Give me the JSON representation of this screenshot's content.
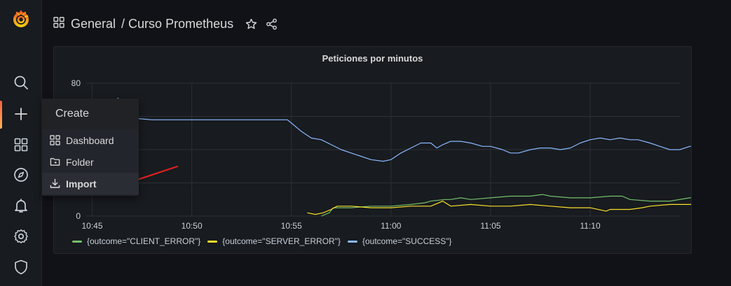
{
  "sidebar": {
    "items": [
      {
        "name": "grafana-logo",
        "icon": "grafana-logo-icon"
      },
      {
        "name": "search",
        "icon": "search-icon"
      },
      {
        "name": "create",
        "icon": "plus-icon",
        "active": true
      },
      {
        "name": "dashboards",
        "icon": "grid-icon"
      },
      {
        "name": "explore",
        "icon": "compass-icon"
      },
      {
        "name": "alerting",
        "icon": "bell-icon"
      },
      {
        "name": "configuration",
        "icon": "gear-icon"
      },
      {
        "name": "server-admin",
        "icon": "shield-icon"
      }
    ]
  },
  "breadcrumb": {
    "folder": "General",
    "title": "/ Curso Prometheus"
  },
  "create_menu": {
    "header": "Create",
    "items": [
      {
        "label": "Dashboard",
        "icon": "grid-icon"
      },
      {
        "label": "Folder",
        "icon": "folder-icon"
      },
      {
        "label": "Import",
        "icon": "import-icon",
        "highlighted": true
      }
    ]
  },
  "panel": {
    "title": "Peticiones por minutos"
  },
  "chart_data": {
    "type": "line",
    "title": "Peticiones por minutos",
    "xlabel": "",
    "ylabel": "",
    "x_ticks": [
      "10:45",
      "10:50",
      "10:55",
      "11:00",
      "11:05",
      "11:10"
    ],
    "y_ticks": [
      "0",
      "80"
    ],
    "xlim_minutes": [
      "10:44",
      "11:15"
    ],
    "ylim": [
      0,
      80
    ],
    "grid": true,
    "legend_position": "bottom",
    "series": [
      {
        "name": "{outcome=\"CLIENT_ERROR\"}",
        "color": "#73bf69",
        "points": [
          [
            56.5,
            0
          ],
          [
            56.9,
            2
          ],
          [
            57.1,
            5
          ],
          [
            58,
            5
          ],
          [
            59,
            6
          ],
          [
            60,
            6
          ],
          [
            61,
            7
          ],
          [
            61.7,
            8
          ],
          [
            62,
            9
          ],
          [
            62.7,
            10
          ],
          [
            63,
            10
          ],
          [
            63.5,
            11
          ],
          [
            64,
            10
          ],
          [
            65,
            11
          ],
          [
            66,
            12
          ],
          [
            67,
            12
          ],
          [
            67.6,
            13
          ],
          [
            68,
            12
          ],
          [
            69,
            11
          ],
          [
            70,
            11
          ],
          [
            71,
            12
          ],
          [
            71.6,
            12
          ],
          [
            72,
            10
          ],
          [
            73,
            9
          ],
          [
            74,
            9
          ],
          [
            75,
            11
          ],
          [
            75.5,
            11
          ]
        ]
      },
      {
        "name": "{outcome=\"SERVER_ERROR\"}",
        "color": "#fade2a",
        "points": [
          [
            55.8,
            2
          ],
          [
            56.2,
            1
          ],
          [
            56.6,
            2
          ],
          [
            57,
            4
          ],
          [
            57.3,
            6
          ],
          [
            58,
            6
          ],
          [
            59,
            5
          ],
          [
            60,
            5
          ],
          [
            61,
            6
          ],
          [
            62,
            6
          ],
          [
            62.6,
            9
          ],
          [
            63,
            6
          ],
          [
            64,
            7
          ],
          [
            65,
            6
          ],
          [
            66,
            6
          ],
          [
            67,
            7
          ],
          [
            68,
            6
          ],
          [
            69,
            5
          ],
          [
            70,
            5
          ],
          [
            70.8,
            3
          ],
          [
            71,
            4
          ],
          [
            72,
            4
          ],
          [
            72.6,
            5
          ],
          [
            73,
            6
          ],
          [
            74,
            7
          ],
          [
            75,
            7
          ],
          [
            75.5,
            7
          ]
        ]
      },
      {
        "name": "{outcome=\"SUCCESS\"}",
        "color": "#8ab8ff",
        "points": [
          [
            45.6,
            64
          ],
          [
            46.3,
            71
          ],
          [
            46.6,
            58
          ],
          [
            47,
            59
          ],
          [
            48,
            58
          ],
          [
            49,
            58
          ],
          [
            50,
            58
          ],
          [
            51,
            58
          ],
          [
            52,
            58
          ],
          [
            53,
            58
          ],
          [
            54,
            58
          ],
          [
            54.8,
            58
          ],
          [
            55,
            56
          ],
          [
            55.5,
            51
          ],
          [
            56,
            47
          ],
          [
            56.5,
            46
          ],
          [
            57,
            43
          ],
          [
            57.5,
            40
          ],
          [
            58,
            38
          ],
          [
            58.5,
            36
          ],
          [
            59,
            34
          ],
          [
            59.6,
            33
          ],
          [
            60,
            34
          ],
          [
            60.5,
            38
          ],
          [
            61,
            41
          ],
          [
            61.5,
            44
          ],
          [
            62,
            44
          ],
          [
            62.3,
            41
          ],
          [
            62.6,
            43
          ],
          [
            63,
            45
          ],
          [
            63.5,
            45
          ],
          [
            64,
            44
          ],
          [
            64.6,
            42
          ],
          [
            65,
            42
          ],
          [
            65.6,
            40
          ],
          [
            66,
            38
          ],
          [
            66.4,
            38
          ],
          [
            67,
            40
          ],
          [
            67.5,
            41
          ],
          [
            68,
            41
          ],
          [
            68.5,
            40
          ],
          [
            69,
            41
          ],
          [
            69.5,
            44
          ],
          [
            70,
            46
          ],
          [
            70.5,
            47
          ],
          [
            71,
            46
          ],
          [
            71.5,
            47
          ],
          [
            72,
            46
          ],
          [
            72.4,
            46
          ],
          [
            73,
            44
          ],
          [
            73.5,
            42
          ],
          [
            74,
            40
          ],
          [
            74.5,
            40
          ],
          [
            75,
            42
          ],
          [
            75.5,
            42
          ]
        ]
      }
    ]
  },
  "annotation": {
    "arrow_color": "#e02020"
  }
}
